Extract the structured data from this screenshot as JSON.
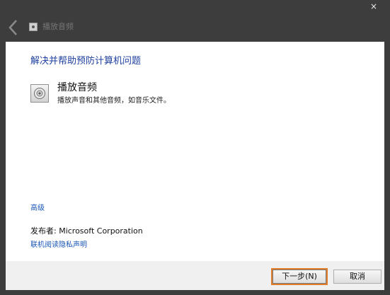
{
  "window": {
    "title": "播放音频",
    "close_glyph": "×"
  },
  "content": {
    "heading": "解决并帮助预防计算机问题",
    "task": {
      "title": "播放音频",
      "description": "播放声音和其他音频，如音乐文件。",
      "icon": "speaker-icon"
    },
    "advanced_link": "高级",
    "publisher": "发布者:  Microsoft Corporation",
    "privacy_link": "联机阅读隐私声明"
  },
  "footer": {
    "next_label": "下一步(N)",
    "cancel_label": "取消"
  },
  "colors": {
    "heading": "#1e3f9e",
    "link": "#1a56b5",
    "focus_ring": "#e27d2a"
  }
}
